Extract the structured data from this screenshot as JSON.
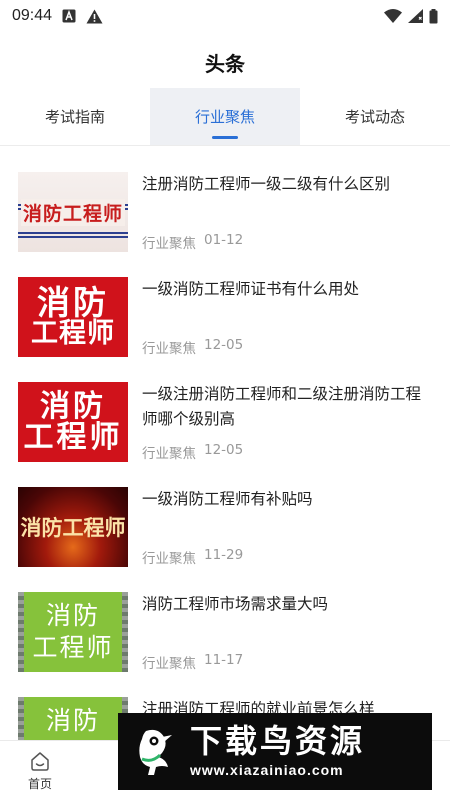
{
  "status_bar": {
    "time": "09:44"
  },
  "header": {
    "title": "头条"
  },
  "tabs": [
    {
      "label": "考试指南",
      "active": false
    },
    {
      "label": "行业聚焦",
      "active": true
    },
    {
      "label": "考试动态",
      "active": false
    }
  ],
  "news": [
    {
      "title": "注册消防工程师一级二级有什么区别",
      "category": "行业聚焦",
      "date": "01-12",
      "thumb_lines": [
        "消防工程师"
      ]
    },
    {
      "title": "一级消防工程师证书有什么用处",
      "category": "行业聚焦",
      "date": "12-05",
      "thumb_lines": [
        "消防",
        "工程师"
      ]
    },
    {
      "title": "一级注册消防工程师和二级注册消防工程师哪个级别高",
      "category": "行业聚焦",
      "date": "12-05",
      "thumb_lines": [
        "消防",
        "工程师"
      ]
    },
    {
      "title": "一级消防工程师有补贴吗",
      "category": "行业聚焦",
      "date": "11-29",
      "thumb_lines": [
        "消防工程师"
      ]
    },
    {
      "title": "消防工程师市场需求量大吗",
      "category": "行业聚焦",
      "date": "11-17",
      "thumb_lines": [
        "消防",
        "工程师"
      ]
    },
    {
      "title": "注册消防工程师的就业前景怎么样",
      "category": "",
      "date": "",
      "thumb_lines": [
        "消防"
      ]
    }
  ],
  "bottom_nav": {
    "home_label": "首页"
  },
  "watermark": {
    "main": "下载鸟资源",
    "url": "www.xiazainiao.com"
  },
  "colors": {
    "accent": "#2a6fd6",
    "thumb_red": "#d0121b",
    "thumb_green": "#86c23b"
  }
}
